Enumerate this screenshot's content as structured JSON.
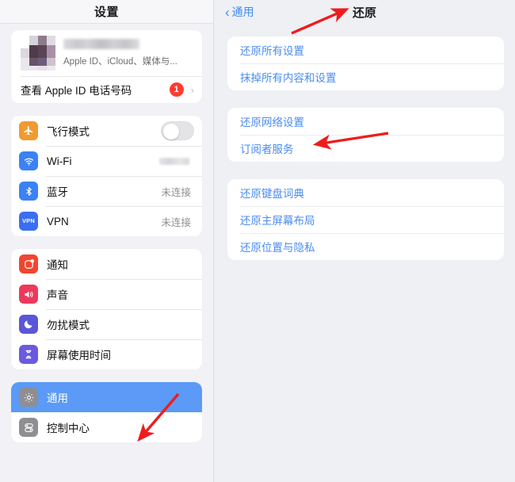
{
  "sidebar": {
    "header_title": "设置",
    "apple_id": {
      "name_redacted": "",
      "subtitle": "Apple ID、iCloud、媒体与...",
      "phone_row_label": "查看 Apple ID 电话号码",
      "badge_count": "1",
      "chevron": "›"
    },
    "connectivity": [
      {
        "label": "飞行模式",
        "value": "",
        "icon": "airplane-icon",
        "icon_glyph": "✈",
        "icon_color": "#f19a32",
        "control": "toggle",
        "toggle_on": false
      },
      {
        "label": "Wi-Fi",
        "value": "",
        "icon": "wifi-icon",
        "icon_glyph": "≈",
        "icon_color": "#3b82f6",
        "control": "blurred-value"
      },
      {
        "label": "蓝牙",
        "value": "未连接",
        "icon": "bluetooth-icon",
        "icon_glyph": "✸",
        "icon_color": "#3b82f6",
        "control": "text"
      },
      {
        "label": "VPN",
        "value": "未连接",
        "icon": "vpn-icon",
        "icon_glyph": "VPN",
        "icon_color": "#3b6ef0",
        "control": "text"
      }
    ],
    "alerts": [
      {
        "label": "通知",
        "icon": "notifications-icon",
        "icon_glyph": "▣",
        "icon_color": "#f2452f"
      },
      {
        "label": "声音",
        "icon": "sound-icon",
        "icon_glyph": "◀",
        "icon_color": "#ec3a5c"
      },
      {
        "label": "勿扰模式",
        "icon": "moon-icon",
        "icon_glyph": "☾",
        "icon_color": "#5b56d8"
      },
      {
        "label": "屏幕使用时间",
        "icon": "hourglass-icon",
        "icon_glyph": "⧗",
        "icon_color": "#6a5ae0"
      }
    ],
    "system": [
      {
        "label": "通用",
        "icon": "gear-icon",
        "icon_glyph": "⚙",
        "icon_color": "#8e8e93",
        "selected": true
      },
      {
        "label": "控制中心",
        "icon": "control-center-icon",
        "icon_glyph": "⊜",
        "icon_color": "#8e8e93",
        "selected": false
      }
    ]
  },
  "detail": {
    "back_label": "通用",
    "back_chevron": "‹",
    "title": "还原",
    "groups": [
      {
        "rows": [
          {
            "label": "还原所有设置"
          },
          {
            "label": "抹掉所有内容和设置"
          }
        ]
      },
      {
        "rows": [
          {
            "label": "还原网络设置"
          },
          {
            "label": "订阅者服务"
          }
        ]
      },
      {
        "rows": [
          {
            "label": "还原键盘词典"
          },
          {
            "label": "还原主屏幕布局"
          },
          {
            "label": "还原位置与隐私"
          }
        ]
      }
    ]
  },
  "annotations": {
    "arrow_color": "#f01c1c",
    "arrows": [
      {
        "name": "arrow-to-title",
        "target": "还原"
      },
      {
        "name": "arrow-to-reset-network",
        "target": "还原网络设置"
      },
      {
        "name": "arrow-to-general",
        "target": "通用"
      }
    ]
  },
  "colors": {
    "accent_blue": "#4a8cf0",
    "selected_row": "#5b9af6",
    "badge_red": "#ff3b30",
    "page_background": "#eef0f4",
    "card_white": "#ffffff"
  }
}
